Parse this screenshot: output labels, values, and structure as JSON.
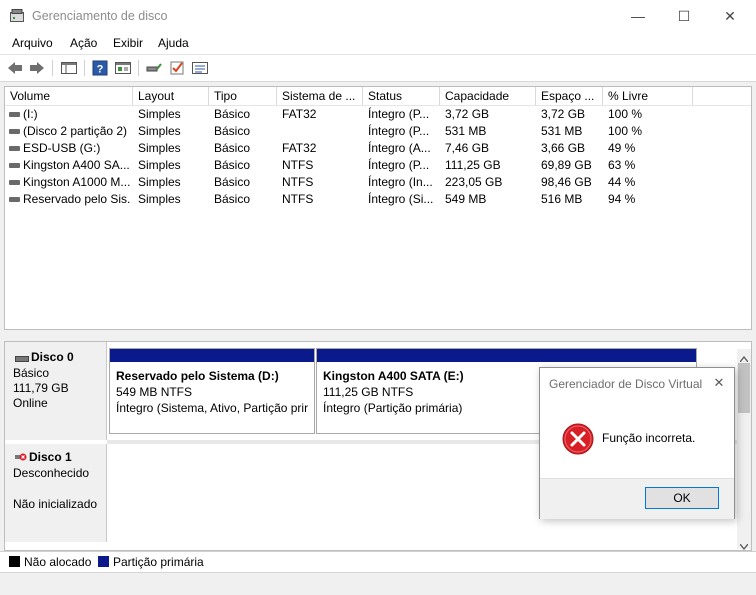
{
  "window": {
    "title": "Gerenciamento de disco",
    "controls": {
      "minimize": "—",
      "maximize": "☐",
      "close": "✕"
    }
  },
  "menu": [
    "Arquivo",
    "Ação",
    "Exibir",
    "Ajuda"
  ],
  "toolbar": [
    "back-icon",
    "forward-icon",
    "console-tree-icon",
    "help-icon",
    "properties-icon",
    "connect-icon",
    "check-icon",
    "list-icon"
  ],
  "table": {
    "columns": [
      "Volume",
      "Layout",
      "Tipo",
      "Sistema de ...",
      "Status",
      "Capacidade",
      "Espaço ...",
      "% Livre"
    ],
    "rows": [
      [
        "(I:)",
        "Simples",
        "Básico",
        "FAT32",
        "Íntegro (P...",
        "3,72 GB",
        "3,72 GB",
        "100 %"
      ],
      [
        "(Disco 2 partição 2)",
        "Simples",
        "Básico",
        "",
        "Íntegro (P...",
        "531 MB",
        "531 MB",
        "100 %"
      ],
      [
        "ESD-USB (G:)",
        "Simples",
        "Básico",
        "FAT32",
        "Íntegro (A...",
        "7,46 GB",
        "3,66 GB",
        "49 %"
      ],
      [
        "Kingston A400 SA...",
        "Simples",
        "Básico",
        "NTFS",
        "Íntegro (P...",
        "111,25 GB",
        "69,89 GB",
        "63 %"
      ],
      [
        "Kingston A1000 M...",
        "Simples",
        "Básico",
        "NTFS",
        "Íntegro (In...",
        "223,05 GB",
        "98,46 GB",
        "44 %"
      ],
      [
        "Reservado pelo Sis...",
        "Simples",
        "Básico",
        "NTFS",
        "Íntegro (Si...",
        "549 MB",
        "516 MB",
        "94 %"
      ]
    ]
  },
  "disks": [
    {
      "name": "Disco 0",
      "type": "Básico",
      "size": "111,79 GB",
      "status": "Online",
      "partitions": [
        {
          "title": "Reservado pelo Sistema  (D:)",
          "size": "549 MB NTFS",
          "status": "Íntegro (Sistema, Ativo, Partição prir"
        },
        {
          "title": "Kingston A400 SATA  (E:)",
          "size": "111,25 GB NTFS",
          "status": "Íntegro (Partição primária)"
        }
      ]
    },
    {
      "name": "Disco 1",
      "type": "Desconhecido",
      "status": "Não inicializado"
    }
  ],
  "legend": [
    {
      "label": "Não alocado",
      "color": "#000000"
    },
    {
      "label": "Partição primária",
      "color": "#0a1a8c"
    }
  ],
  "dialog": {
    "title": "Gerenciador de Disco Virtual",
    "message": "Função incorreta.",
    "ok": "OK",
    "close": "✕"
  },
  "colors": {
    "partition_bar": "#0a1a8c",
    "error_red": "#d71f26"
  }
}
